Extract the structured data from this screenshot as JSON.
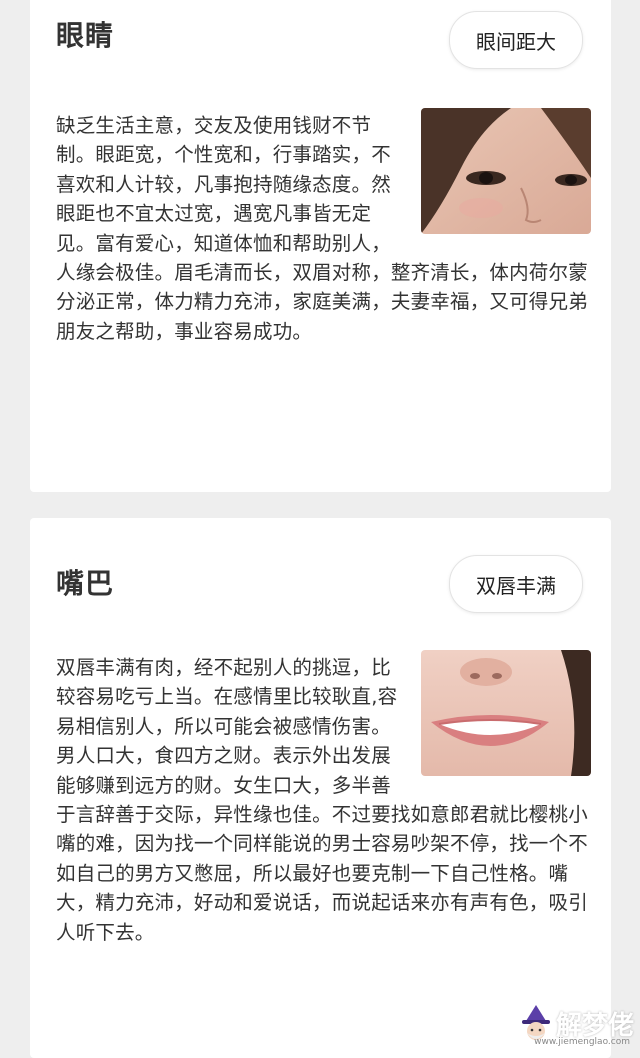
{
  "sections": [
    {
      "title": "眼睛",
      "tag": "眼间距大",
      "image_icon": "eyes-photo",
      "text": "缺乏生活主意，交友及使用钱财不节制。眼距宽，个性宽和，行事踏实，不喜欢和人计较，凡事抱持随缘态度。然眼距也不宜太过宽，遇宽凡事皆无定见。富有爱心，知道体恤和帮助别人，人缘会极佳。眉毛清而长，双眉对称，整齐清长，体内荷尔蒙分泌正常，体力精力充沛，家庭美满，夫妻幸福，又可得兄弟朋友之帮助，事业容易成功。"
    },
    {
      "title": "嘴巴",
      "tag": "双唇丰满",
      "image_icon": "lips-photo",
      "text": "双唇丰满有肉，经不起别人的挑逗，比较容易吃亏上当。在感情里比较耿直,容易相信别人，所以可能会被感情伤害。男人口大，食四方之财。表示外出发展能够赚到远方的财。女生口大，多半善于言辞善于交际，异性缘也佳。不过要找如意郎君就比樱桃小嘴的难，因为找一个同样能说的男士容易吵架不停，找一个不如自己的男方又憋屈，所以最好也要克制一下自己性格。嘴大，精力充沛，好动和爱说话，而说起话来亦有声有色，吸引人听下去。"
    }
  ],
  "watermark": {
    "text": "解梦佬",
    "url": "www.jiemenglao.com",
    "icon": "wizard-icon"
  }
}
